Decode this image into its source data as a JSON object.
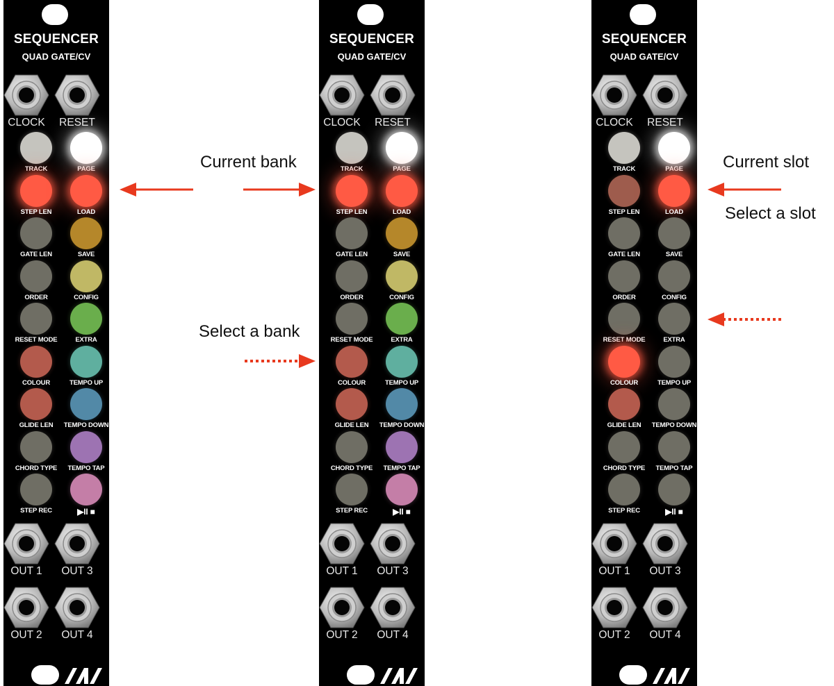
{
  "module": {
    "title": "SEQUENCER",
    "subtitle": "QUAD GATE/CV",
    "input_jacks": [
      "CLOCK",
      "RESET"
    ],
    "output_jacks": [
      "OUT 1",
      "OUT 3",
      "OUT 2",
      "OUT 4"
    ],
    "left_labels": [
      "TRACK",
      "STEP LEN",
      "GATE LEN",
      "ORDER",
      "RESET MODE",
      "COLOUR",
      "GLIDE LEN",
      "CHORD TYPE",
      "STEP REC"
    ],
    "right_labels": [
      "PAGE",
      "LOAD",
      "SAVE",
      "CONFIG",
      "EXTRA",
      "TEMPO UP",
      "TEMPO DOWN",
      "TEMPO TAP",
      "▶︎II ■"
    ],
    "logo_text": "/\\/\\"
  },
  "panels": [
    {
      "name": "bank-view-left",
      "left_colors": [
        "#c5c4be",
        "#ff5a44",
        "#6f6e64",
        "#6f6e64",
        "#6f6e64",
        "#b35a4c",
        "#b35a4c",
        "#6f6e64",
        "#6f6e64"
      ],
      "right_colors": [
        "#ffffff",
        "#ff5a44",
        "#b5872a",
        "#c0b865",
        "#6aae4c",
        "#5faf9f",
        "#5289a7",
        "#9d73b2",
        "#c47ea7"
      ],
      "left_glow": [
        false,
        true,
        false,
        false,
        false,
        false,
        false,
        false,
        false
      ],
      "right_glow": [
        true,
        true,
        false,
        false,
        false,
        false,
        false,
        false,
        false
      ]
    },
    {
      "name": "bank-view-right",
      "left_colors": [
        "#c5c4be",
        "#ff5a44",
        "#6f6e64",
        "#6f6e64",
        "#6f6e64",
        "#b35a4c",
        "#b35a4c",
        "#6f6e64",
        "#6f6e64"
      ],
      "right_colors": [
        "#ffffff",
        "#ff5a44",
        "#b5872a",
        "#c0b865",
        "#6aae4c",
        "#5faf9f",
        "#5289a7",
        "#9d73b2",
        "#c47ea7"
      ],
      "left_glow": [
        false,
        true,
        false,
        false,
        false,
        false,
        false,
        false,
        false
      ],
      "right_glow": [
        true,
        true,
        false,
        false,
        false,
        false,
        false,
        false,
        false
      ]
    },
    {
      "name": "slot-view",
      "left_colors": [
        "#c5c4be",
        "#9e5c4d",
        "#6f6e64",
        "#6f6e64",
        "#6f6e64",
        "#ff5a44",
        "#b35a4c",
        "#6f6e64",
        "#6f6e64"
      ],
      "right_colors": [
        "#ffffff",
        "#ff5a44",
        "#6f6e64",
        "#6f6e64",
        "#6f6e64",
        "#6f6e64",
        "#6f6e64",
        "#6f6e64",
        "#6f6e64"
      ],
      "left_glow": [
        false,
        false,
        false,
        false,
        false,
        true,
        false,
        false,
        false
      ],
      "right_glow": [
        true,
        true,
        false,
        false,
        false,
        false,
        false,
        false,
        false
      ]
    }
  ],
  "annotations": {
    "current_bank": "Current bank",
    "select_bank": "Select a bank",
    "current_slot": "Current slot",
    "select_slot": "Select a slot"
  },
  "colors": {
    "panel": "#000000",
    "arrow": "#e8391e",
    "label": "#ffffff"
  }
}
